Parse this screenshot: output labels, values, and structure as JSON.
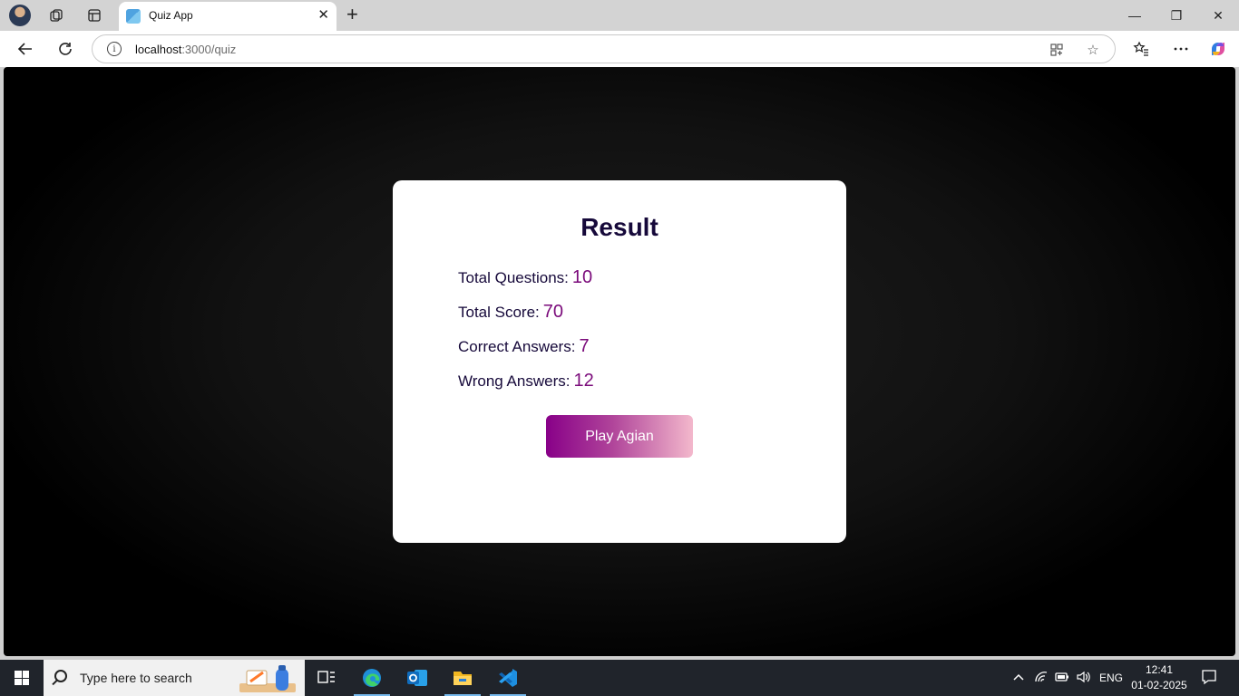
{
  "browser": {
    "tab_title": "Quiz App",
    "tab_close": "✕",
    "new_tab": "+",
    "url_host": "localhost",
    "url_path": ":3000/quiz",
    "window_controls": {
      "minimize": "—",
      "restore": "❐",
      "close": "✕"
    },
    "icons": [
      "profile-avatar",
      "collections-icon",
      "tab-actions-icon",
      "back-icon",
      "refresh-icon",
      "info-icon",
      "app-available-icon",
      "favorite-star-icon",
      "favorites-icon",
      "more-icon",
      "copilot-icon"
    ]
  },
  "quiz_result": {
    "title": "Result",
    "stats": [
      {
        "label": "Total Questions:",
        "value": "10"
      },
      {
        "label": "Total Score:",
        "value": "70"
      },
      {
        "label": "Correct Answers:",
        "value": "7"
      },
      {
        "label": "Wrong Answers:",
        "value": "12"
      }
    ],
    "play_again_label": "Play Agian"
  },
  "taskbar": {
    "search_placeholder": "Type here to search",
    "apps": [
      "task-view-icon",
      "edge-icon",
      "outlook-icon",
      "file-explorer-icon",
      "vscode-icon"
    ],
    "language": "ENG",
    "time": "12:41",
    "date": "01-02-2025"
  },
  "colors": {
    "title_text": "#16093a",
    "value_text": "#7a0a7a",
    "button_gradient_start": "#880088",
    "button_gradient_end": "#f3b8cc",
    "page_background": "#000000"
  }
}
